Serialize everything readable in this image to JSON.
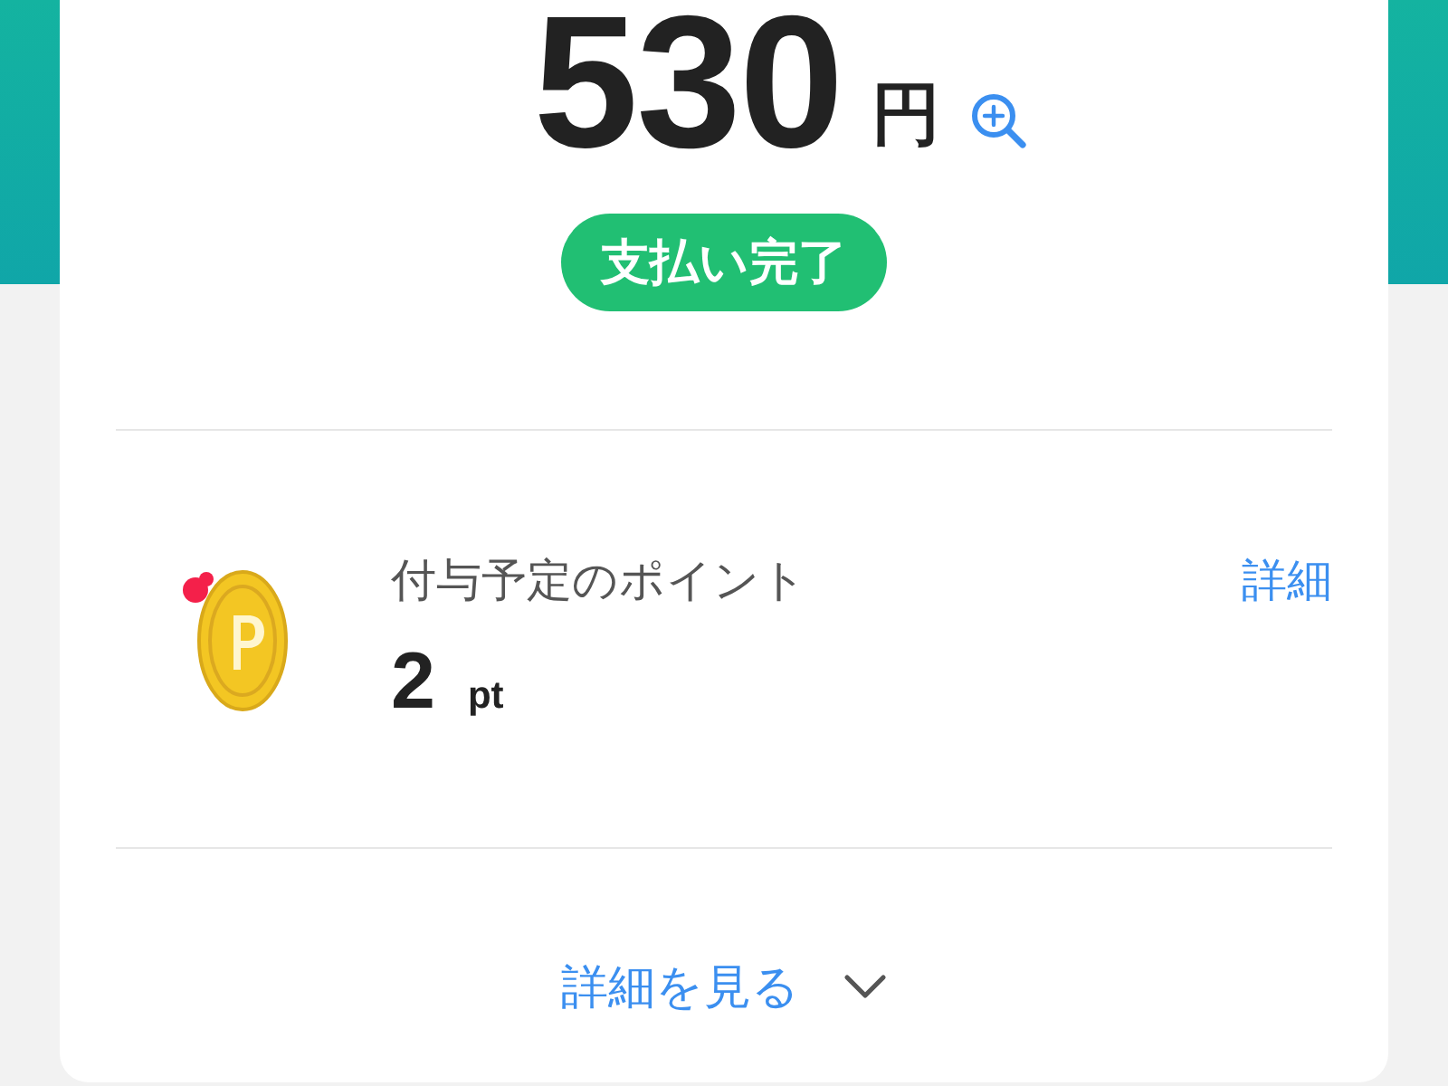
{
  "amount": {
    "value": "530",
    "unit": "円"
  },
  "status_badge": {
    "label": "支払い完了"
  },
  "points": {
    "label": "付与予定のポイント",
    "link": "詳細",
    "value": "2",
    "unit": "pt"
  },
  "expand": {
    "label": "詳細を見る",
    "expanded": false
  }
}
